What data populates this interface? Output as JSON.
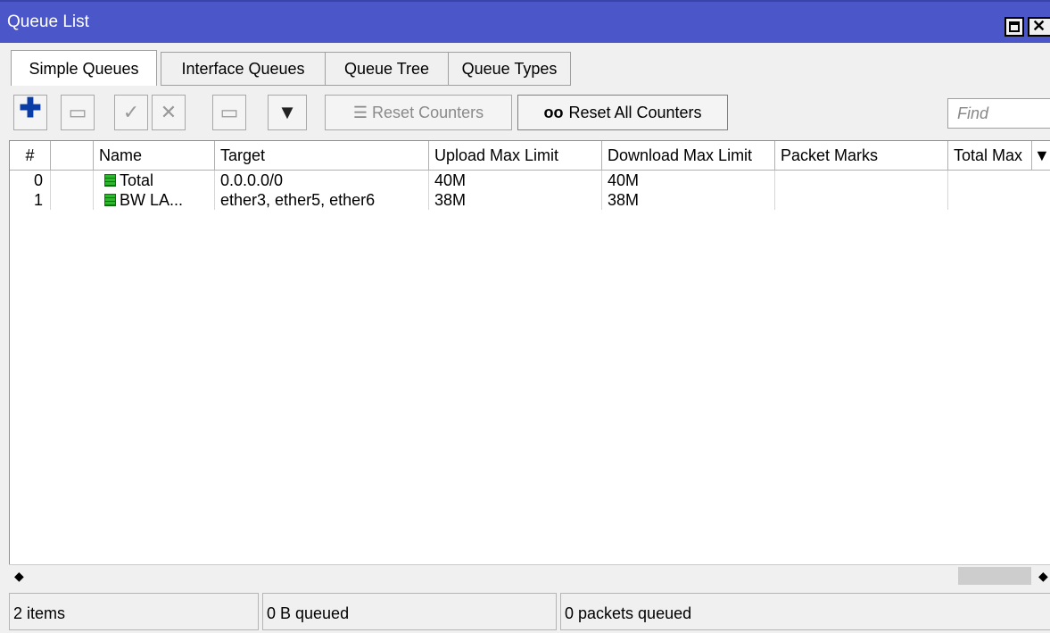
{
  "window": {
    "title": "Queue List"
  },
  "tabs": [
    "Simple Queues",
    "Interface Queues",
    "Queue Tree",
    "Queue Types"
  ],
  "toolbar": {
    "reset_counters": "Reset Counters",
    "reset_all_icon": "oo",
    "reset_all_counters": "Reset All Counters",
    "find_placeholder": "Find"
  },
  "table": {
    "columns": [
      "#",
      "",
      "Name",
      "Target",
      "Upload Max Limit",
      "Download Max Limit",
      "Packet Marks",
      "Total Max"
    ],
    "rows": [
      {
        "num": "0",
        "name": "Total",
        "target": "0.0.0.0/0",
        "upload": "40M",
        "download": "40M",
        "marks": "",
        "total": ""
      },
      {
        "num": "1",
        "name": "BW LA...",
        "target": "ether3, ether5, ether6",
        "upload": "38M",
        "download": "38M",
        "marks": "",
        "total": ""
      }
    ]
  },
  "status": {
    "items": "2 items",
    "queued": "0 B queued",
    "packets": "0 packets queued"
  },
  "colors": {
    "titlebar": "#4b57c8",
    "queue_icon": "#2fb52f",
    "add_icon": "#0a3da6"
  }
}
